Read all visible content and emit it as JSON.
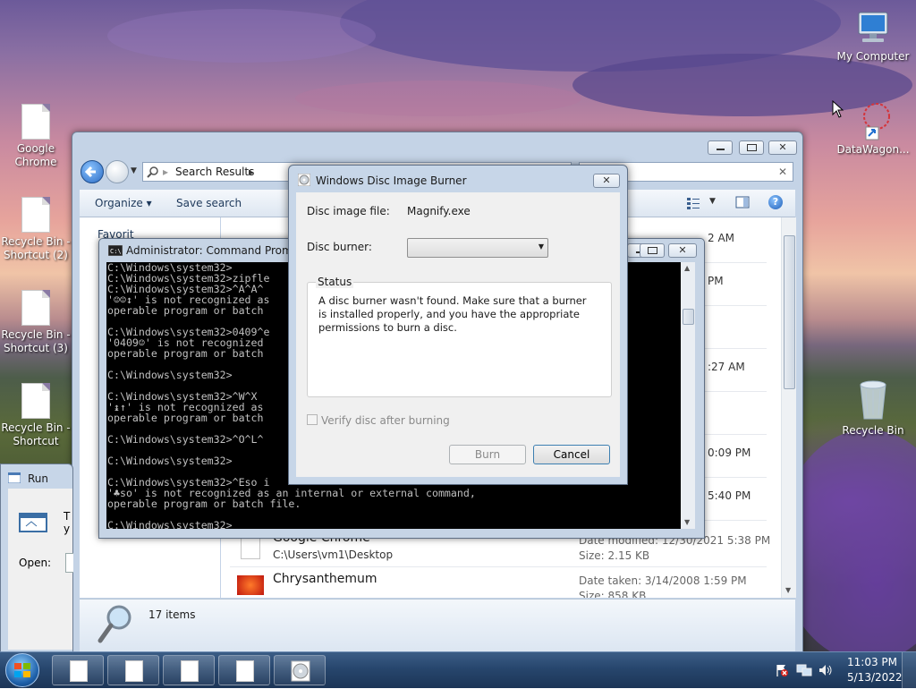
{
  "desktop": {
    "icons": [
      {
        "id": "google-chrome",
        "label": "Google Chrome"
      },
      {
        "id": "recycle-bin-2",
        "label": "Recycle Bin - Shortcut (2)"
      },
      {
        "id": "recycle-bin-3",
        "label": "Recycle Bin - Shortcut (3)"
      },
      {
        "id": "recycle-bin-shortcut",
        "label": "Recycle Bin - Shortcut"
      },
      {
        "id": "my-computer",
        "label": "My Computer"
      },
      {
        "id": "datawagon",
        "label": "DataWagon..."
      },
      {
        "id": "recycle-bin",
        "label": "Recycle Bin"
      }
    ]
  },
  "explorer": {
    "address": "Search Results",
    "toolbar": {
      "organize": "Organize",
      "save_search": "Save search"
    },
    "nav_partial": "Favorit",
    "right_col": [
      "2 AM",
      "PM",
      ":27 AM",
      "0:09 PM",
      "5:40 PM"
    ],
    "files": [
      {
        "name": "Google Chrome",
        "path": "C:\\Users\\vm1\\Desktop",
        "meta1": "Date modified: 12/30/2021 5:38 PM",
        "meta2": "Size: 2.15 KB"
      },
      {
        "name": "Chrysanthemum",
        "path": "",
        "meta1": "Date taken: 3/14/2008 1:59 PM",
        "meta2": "Size: 858 KB"
      }
    ],
    "status": "17 items"
  },
  "cmd": {
    "title": "Administrator: Command Prompt",
    "lines": [
      "C:\\Windows\\system32>",
      "C:\\Windows\\system32>zipfle",
      "C:\\Windows\\system32>^A^A^",
      "'☺☺↕' is not recognized as",
      "operable program or batch",
      "",
      "C:\\Windows\\system32>0409^e",
      "'0409☺' is not recognized",
      "operable program or batch",
      "",
      "C:\\Windows\\system32>",
      "",
      "C:\\Windows\\system32>^W^X",
      "'↨↑' is not recognized as",
      "operable program or batch",
      "",
      "C:\\Windows\\system32>^O^L^",
      "",
      "C:\\Windows\\system32>",
      "",
      "C:\\Windows\\system32>^Eso i",
      "'♣so' is not recognized as an internal or external command,",
      "operable program or batch file.",
      "",
      "C:\\Windows\\system32>_"
    ]
  },
  "burner": {
    "title": "Windows Disc Image Burner",
    "disc_image_label": "Disc image file:",
    "disc_image_value": "Magnify.exe",
    "disc_burner_label": "Disc burner:",
    "disc_burner_value": "",
    "status_label": "Status",
    "status_text": "A disc burner wasn't found. Make sure that a burner is installed properly, and you have the appropriate permissions to burn a disc.",
    "verify_label": "Verify disc after burning",
    "verify_checked": false,
    "burn_label": "Burn",
    "cancel_label": "Cancel"
  },
  "run": {
    "title": "Run",
    "text_partial": "Ty re",
    "open_label": "Open:"
  },
  "taskbar": {
    "time": "11:03 PM",
    "date": "5/13/2022"
  },
  "colors": {
    "accent": "#1e395b",
    "taskbar": "#27466d",
    "cmd_bg": "#000000",
    "cmd_fg": "#c0c0c0",
    "dialog_frame": "#c7d6e8"
  }
}
